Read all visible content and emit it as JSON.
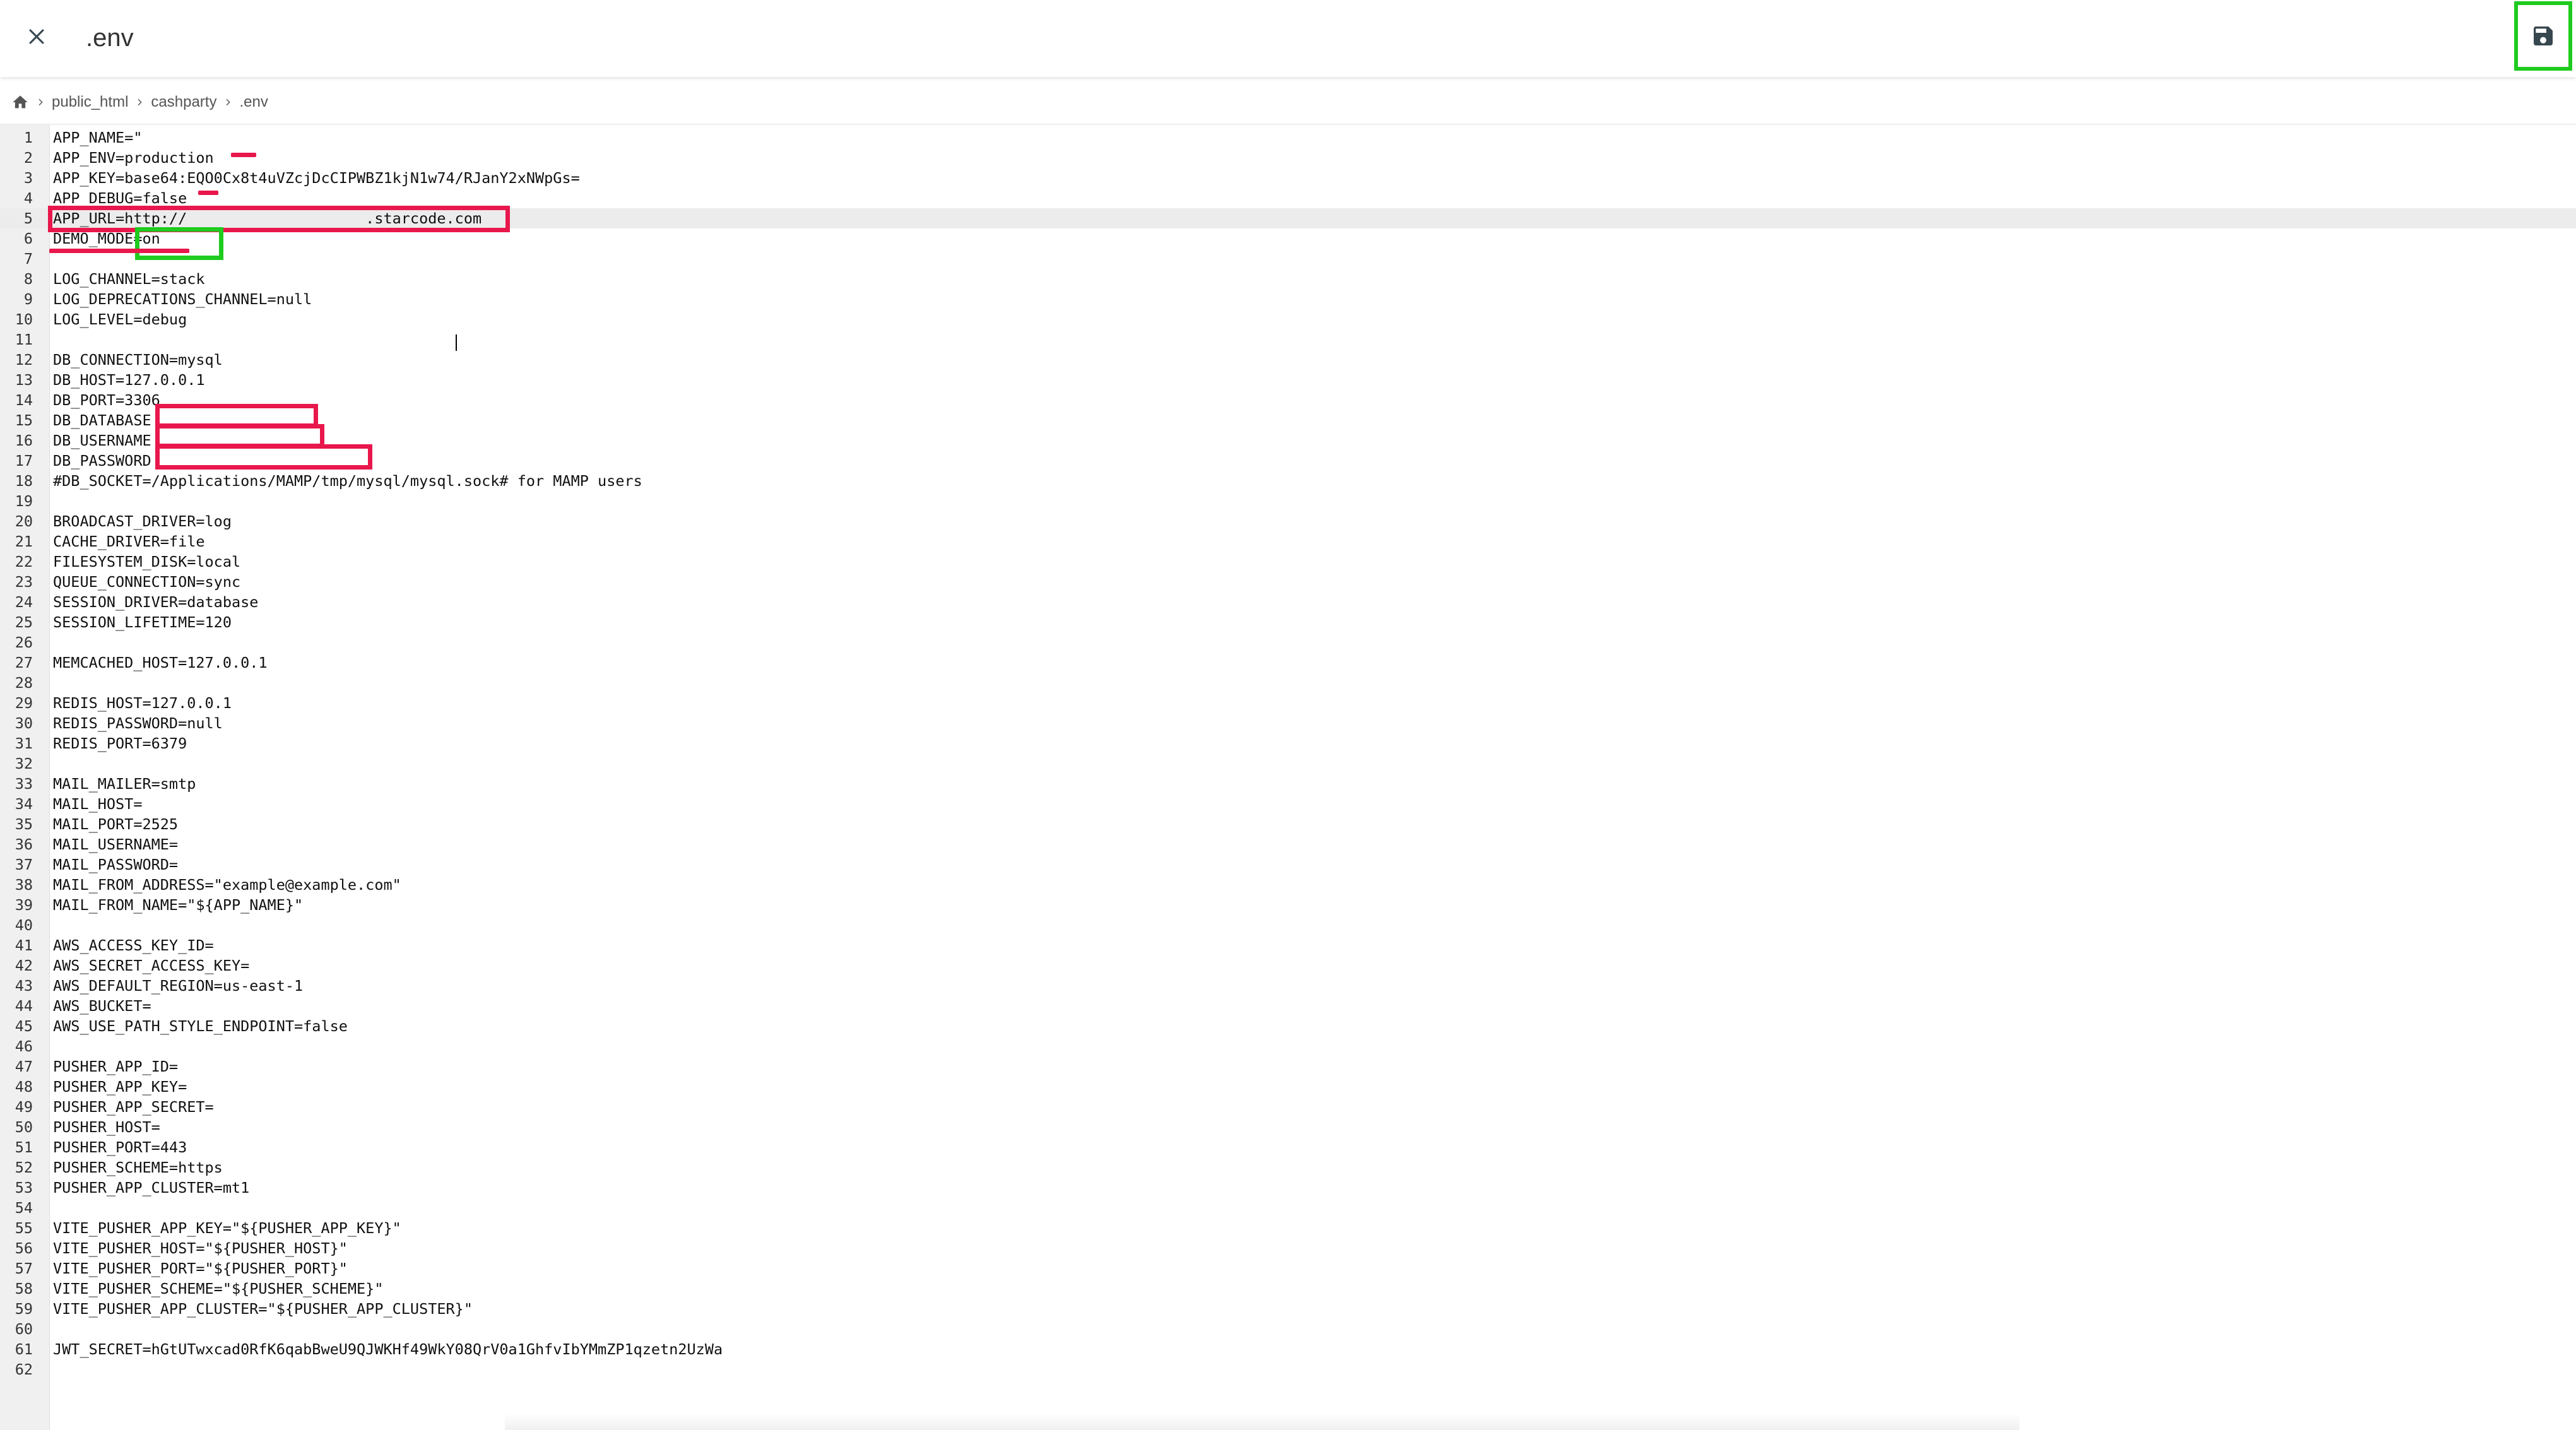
{
  "header": {
    "file_name": ".env",
    "close_icon": "close-icon",
    "save_icon": "save-icon"
  },
  "breadcrumb": {
    "home_icon": "home-icon",
    "items": [
      "public_html",
      "cashparty",
      ".env"
    ]
  },
  "editor": {
    "active_line": 5,
    "lines": [
      {
        "n": "1",
        "t": "APP_NAME=\""
      },
      {
        "n": "2",
        "t": "APP_ENV=production"
      },
      {
        "n": "3",
        "t": "APP_KEY=base64:EQO0Cx8t4uVZcjDcCIPWBZ1kjN1w74/RJanY2xNWpGs="
      },
      {
        "n": "4",
        "t": "APP_DEBUG=false"
      },
      {
        "n": "5",
        "t": "APP_URL=http://                    .starcode.com"
      },
      {
        "n": "6",
        "t": "DEMO_MODE=on"
      },
      {
        "n": "7",
        "t": ""
      },
      {
        "n": "8",
        "t": "LOG_CHANNEL=stack"
      },
      {
        "n": "9",
        "t": "LOG_DEPRECATIONS_CHANNEL=null"
      },
      {
        "n": "10",
        "t": "LOG_LEVEL=debug"
      },
      {
        "n": "11",
        "t": ""
      },
      {
        "n": "12",
        "t": "DB_CONNECTION=mysql"
      },
      {
        "n": "13",
        "t": "DB_HOST=127.0.0.1"
      },
      {
        "n": "14",
        "t": "DB_PORT=3306"
      },
      {
        "n": "15",
        "t": "DB_DATABASE"
      },
      {
        "n": "16",
        "t": "DB_USERNAME"
      },
      {
        "n": "17",
        "t": "DB_PASSWORD"
      },
      {
        "n": "18",
        "t": "#DB_SOCKET=/Applications/MAMP/tmp/mysql/mysql.sock# for MAMP users"
      },
      {
        "n": "19",
        "t": ""
      },
      {
        "n": "20",
        "t": "BROADCAST_DRIVER=log"
      },
      {
        "n": "21",
        "t": "CACHE_DRIVER=file"
      },
      {
        "n": "22",
        "t": "FILESYSTEM_DISK=local"
      },
      {
        "n": "23",
        "t": "QUEUE_CONNECTION=sync"
      },
      {
        "n": "24",
        "t": "SESSION_DRIVER=database"
      },
      {
        "n": "25",
        "t": "SESSION_LIFETIME=120"
      },
      {
        "n": "26",
        "t": ""
      },
      {
        "n": "27",
        "t": "MEMCACHED_HOST=127.0.0.1"
      },
      {
        "n": "28",
        "t": ""
      },
      {
        "n": "29",
        "t": "REDIS_HOST=127.0.0.1"
      },
      {
        "n": "30",
        "t": "REDIS_PASSWORD=null"
      },
      {
        "n": "31",
        "t": "REDIS_PORT=6379"
      },
      {
        "n": "32",
        "t": ""
      },
      {
        "n": "33",
        "t": "MAIL_MAILER=smtp"
      },
      {
        "n": "34",
        "t": "MAIL_HOST="
      },
      {
        "n": "35",
        "t": "MAIL_PORT=2525"
      },
      {
        "n": "36",
        "t": "MAIL_USERNAME="
      },
      {
        "n": "37",
        "t": "MAIL_PASSWORD="
      },
      {
        "n": "38",
        "t": "MAIL_FROM_ADDRESS=\"example@example.com\""
      },
      {
        "n": "39",
        "t": "MAIL_FROM_NAME=\"${APP_NAME}\""
      },
      {
        "n": "40",
        "t": ""
      },
      {
        "n": "41",
        "t": "AWS_ACCESS_KEY_ID="
      },
      {
        "n": "42",
        "t": "AWS_SECRET_ACCESS_KEY="
      },
      {
        "n": "43",
        "t": "AWS_DEFAULT_REGION=us-east-1"
      },
      {
        "n": "44",
        "t": "AWS_BUCKET="
      },
      {
        "n": "45",
        "t": "AWS_USE_PATH_STYLE_ENDPOINT=false"
      },
      {
        "n": "46",
        "t": ""
      },
      {
        "n": "47",
        "t": "PUSHER_APP_ID="
      },
      {
        "n": "48",
        "t": "PUSHER_APP_KEY="
      },
      {
        "n": "49",
        "t": "PUSHER_APP_SECRET="
      },
      {
        "n": "50",
        "t": "PUSHER_HOST="
      },
      {
        "n": "51",
        "t": "PUSHER_PORT=443"
      },
      {
        "n": "52",
        "t": "PUSHER_SCHEME=https"
      },
      {
        "n": "53",
        "t": "PUSHER_APP_CLUSTER=mt1"
      },
      {
        "n": "54",
        "t": ""
      },
      {
        "n": "55",
        "t": "VITE_PUSHER_APP_KEY=\"${PUSHER_APP_KEY}\""
      },
      {
        "n": "56",
        "t": "VITE_PUSHER_HOST=\"${PUSHER_HOST}\""
      },
      {
        "n": "57",
        "t": "VITE_PUSHER_PORT=\"${PUSHER_PORT}\""
      },
      {
        "n": "58",
        "t": "VITE_PUSHER_SCHEME=\"${PUSHER_SCHEME}\""
      },
      {
        "n": "59",
        "t": "VITE_PUSHER_APP_CLUSTER=\"${PUSHER_APP_CLUSTER}\""
      },
      {
        "n": "60",
        "t": ""
      },
      {
        "n": "61",
        "t": "JWT_SECRET=hGtUTwxcad0RfK6qabBweU9QJWKHf49WkY08QrV0a1GhfvIbYMmZP1qzetn2UzWa"
      },
      {
        "n": "62",
        "t": ""
      }
    ]
  },
  "colors": {
    "highlight_red": "#e8174c",
    "highlight_green": "#1ecb1e",
    "gutter_bg": "#f0f0f0",
    "active_line_bg": "#ececec"
  }
}
